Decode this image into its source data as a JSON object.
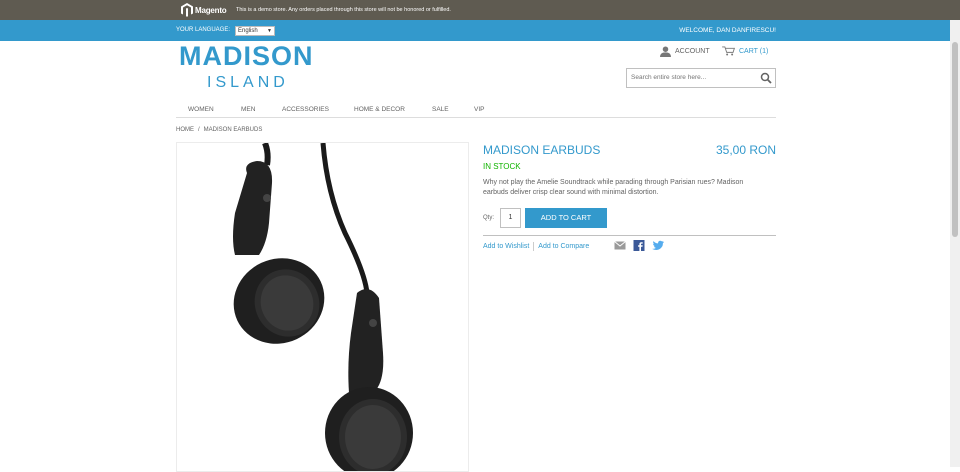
{
  "demo_notice": {
    "logo_text": "Magento",
    "message": "This is a demo store. Any orders placed through this store will not be honored or fulfilled."
  },
  "header_bar": {
    "language_label": "YOUR LANGUAGE:",
    "language_value": "English",
    "welcome": "WELCOME, DAN DANFIRESCU!"
  },
  "logo": {
    "main": "MADISON",
    "sub": "ISLAND"
  },
  "account": {
    "label": "ACCOUNT",
    "icon": "user-icon"
  },
  "cart": {
    "label": "CART (1)",
    "icon": "cart-icon"
  },
  "search": {
    "placeholder": "Search entire store here..."
  },
  "nav": {
    "items": [
      "WOMEN",
      "MEN",
      "ACCESSORIES",
      "HOME & DECOR",
      "SALE",
      "VIP"
    ]
  },
  "breadcrumb": {
    "home": "HOME",
    "sep": "/",
    "current": "MADISON EARBUDS"
  },
  "product": {
    "name": "MADISON EARBUDS",
    "price": "35,00 RON",
    "availability": "IN STOCK",
    "description": "Why not play the Amelie Soundtrack while parading through Parisian rues? Madison earbuds deliver crisp clear sound with minimal distortion.",
    "qty_label": "Qty:",
    "qty_value": "1",
    "add_to_cart": "ADD TO CART",
    "wishlist": "Add to Wishlist",
    "compare": "Add to Compare"
  },
  "colors": {
    "accent": "#3399cc",
    "demo_bar": "#5f5b51",
    "in_stock": "#11b400"
  }
}
